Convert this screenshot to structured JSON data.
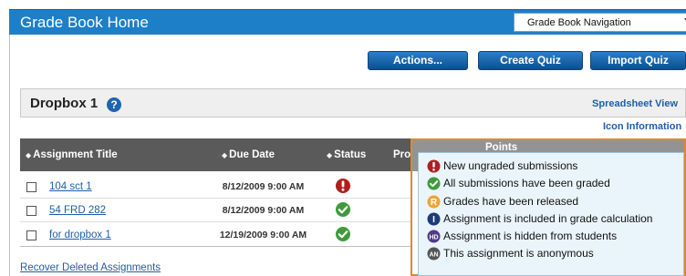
{
  "header": {
    "title": "Grade Book Home",
    "navigation_select": "Grade Book Navigation"
  },
  "toolbar": {
    "actions_label": "Actions...",
    "create_quiz_label": "Create Quiz",
    "import_quiz_label": "Import Quiz"
  },
  "section": {
    "title": "Dropbox 1",
    "spreadsheet_view": "Spreadsheet View",
    "icon_information": "Icon Information"
  },
  "table": {
    "columns": [
      "Assignment Title",
      "Due Date",
      "Status",
      "Pro",
      "Points"
    ],
    "rows": [
      {
        "title": "104 sct 1",
        "due": "8/12/2009 9:00 AM",
        "status_icon": "new-ungraded-icon"
      },
      {
        "title": "54 FRD 282",
        "due": "8/12/2009 9:00 AM",
        "status_icon": "all-graded-icon"
      },
      {
        "title": "for dropbox 1",
        "due": "12/19/2009 9:00 AM",
        "status_icon": "all-graded-icon"
      }
    ]
  },
  "recover_link": "Recover Deleted Assignments",
  "legend": {
    "items": [
      {
        "icon": "new-ungraded-icon",
        "label": "New ungraded submissions"
      },
      {
        "icon": "all-graded-icon",
        "label": "All submissions have been graded"
      },
      {
        "icon": "released-icon",
        "label": "Grades have been released"
      },
      {
        "icon": "included-icon",
        "label": "Assignment is included in grade calculation"
      },
      {
        "icon": "hidden-icon",
        "label": "Assignment is hidden from students"
      },
      {
        "icon": "anonymous-icon",
        "label": "This assignment is anonymous"
      }
    ],
    "icon_letters": {
      "released": "R",
      "included": "I",
      "hidden": "HD",
      "anonymous": "AN"
    }
  },
  "colors": {
    "header_blue": "#1d7fc8",
    "button_blue": "#0d4f8e",
    "link_blue": "#1f5ea8",
    "table_header": "#5a5a5a",
    "legend_border": "#e0892b",
    "legend_bg": "#eaf5fb",
    "error_red": "#b01e1e",
    "success_green": "#3f9b3a",
    "released_orange": "#f0a431",
    "included_navy": "#1d3b78",
    "hidden_purple": "#4f3b8a",
    "anonymous_gray": "#555555"
  }
}
